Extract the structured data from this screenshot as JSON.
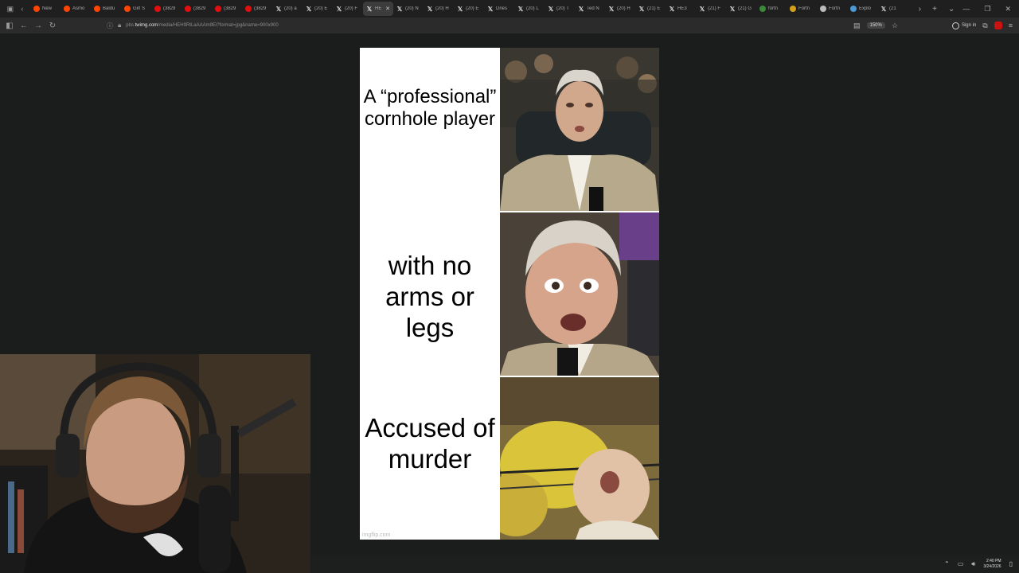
{
  "tabs": [
    {
      "label": "New",
      "icon": "reddit-icon",
      "color": "#ff4500"
    },
    {
      "label": "Asmo",
      "icon": "reddit-icon",
      "color": "#ff4500"
    },
    {
      "label": "Baldu",
      "icon": "reddit-icon",
      "color": "#ff4500"
    },
    {
      "label": "Girl S",
      "icon": "reddit-icon",
      "color": "#ff4500"
    },
    {
      "label": "(3829",
      "icon": "youtube-icon",
      "color": "#e01010"
    },
    {
      "label": "(3829",
      "icon": "youtube-icon",
      "color": "#e01010"
    },
    {
      "label": "(3829",
      "icon": "youtube-icon",
      "color": "#e01010"
    },
    {
      "label": "(3829",
      "icon": "youtube-icon",
      "color": "#e01010"
    },
    {
      "label": "(20) a",
      "icon": "x-icon"
    },
    {
      "label": "(20) E",
      "icon": "x-icon"
    },
    {
      "label": "(20) F",
      "icon": "x-icon"
    },
    {
      "label": "HE",
      "icon": "x-icon",
      "active": true
    },
    {
      "label": "(20) N",
      "icon": "x-icon"
    },
    {
      "label": "(20) H",
      "icon": "x-icon"
    },
    {
      "label": "(20) E",
      "icon": "x-icon"
    },
    {
      "label": "Dries",
      "icon": "x-icon"
    },
    {
      "label": "(20) L",
      "icon": "x-icon"
    },
    {
      "label": "(20) T",
      "icon": "x-icon"
    },
    {
      "label": "Ted N",
      "icon": "x-icon"
    },
    {
      "label": "(20) H",
      "icon": "x-icon"
    },
    {
      "label": "(21) E",
      "icon": "x-icon"
    },
    {
      "label": "HE3",
      "icon": "x-icon"
    },
    {
      "label": "(21) F",
      "icon": "x-icon"
    },
    {
      "label": "(21) G",
      "icon": "x-icon"
    },
    {
      "label": "fortn",
      "icon": "globe-icon",
      "color": "#3a8a3a"
    },
    {
      "label": "Fortn",
      "icon": "globe-icon",
      "color": "#d4a017"
    },
    {
      "label": "Fortn",
      "icon": "fortnite-icon",
      "color": "#bbbbbb"
    },
    {
      "label": "Explo",
      "icon": "chart-icon",
      "color": "#4a9ad4"
    },
    {
      "label": "(21",
      "icon": "x-icon"
    }
  ],
  "address": {
    "prefix": "pbs.",
    "domain": "twimg.com",
    "path": "/media/HEH9RtLaAAAm9Ei?format=jpg&name=900x900"
  },
  "zoom": "150%",
  "signin_label": "Sign in",
  "meme": {
    "caption1": "A “professional” cornhole player",
    "caption2": "with no arms or legs",
    "caption3": "Accused of murder",
    "watermark": "imgflip.com"
  },
  "clock": {
    "time": "2:40 PM",
    "date": "3/24/2026"
  }
}
